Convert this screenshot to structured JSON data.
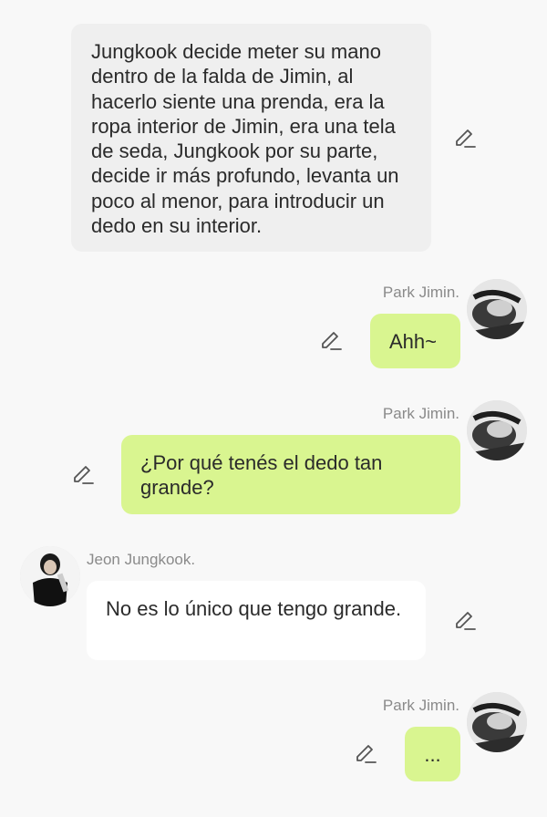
{
  "messages": [
    {
      "type": "narration",
      "text": "Jungkook decide meter su mano dentro de la falda de Jimin, al hacerlo siente una prenda, era la ropa interior de Jimin, era una tela de seda, Jungkook por su parte, decide ir más profundo, levanta un poco al menor, para introducir un dedo en su interior."
    },
    {
      "type": "right",
      "name": "Park Jimin.",
      "text": "Ahh~"
    },
    {
      "type": "right",
      "name": "Park Jimin.",
      "text": "¿Por qué tenés el dedo tan grande?"
    },
    {
      "type": "left",
      "name": "Jeon Jungkook.",
      "text": "No es lo único que tengo grande."
    },
    {
      "type": "right",
      "name": "Park Jimin.",
      "text": "..."
    }
  ],
  "icons": {
    "edit": "pencil-edit-icon"
  },
  "colors": {
    "green_bubble": "#d9f590",
    "narration_bubble": "#efefef",
    "white_bubble": "#ffffff",
    "background": "#f8f8f8"
  }
}
